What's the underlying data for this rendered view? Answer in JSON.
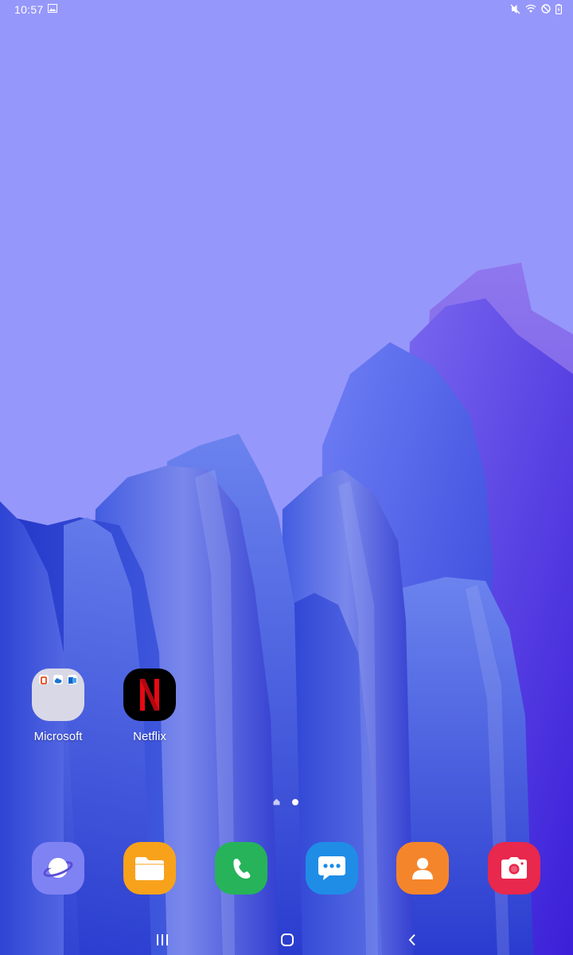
{
  "status_bar": {
    "time": "10:57",
    "icons": [
      "gallery-icon",
      "mute-icon",
      "wifi-icon",
      "do-not-disturb-icon",
      "battery-icon"
    ]
  },
  "home": {
    "apps": [
      {
        "label": "Microsoft",
        "icon": "folder-icon"
      },
      {
        "label": "Netflix",
        "icon": "netflix-icon",
        "glyph": "N"
      }
    ],
    "page_count": 2,
    "current_page": 2
  },
  "dock": [
    {
      "name": "internet",
      "icon": "planet-icon",
      "color": "#7f82f2"
    },
    {
      "name": "my-files",
      "icon": "folder-icon",
      "color": "#f8a21c"
    },
    {
      "name": "phone",
      "icon": "phone-icon",
      "color": "#26b35a"
    },
    {
      "name": "messages",
      "icon": "chat-bubble-icon",
      "color": "#1f8de6"
    },
    {
      "name": "contacts",
      "icon": "person-icon",
      "color": "#f5852b"
    },
    {
      "name": "camera",
      "icon": "camera-icon",
      "color": "#e8284c"
    }
  ],
  "nav_bar": {
    "buttons": [
      "recents-icon",
      "home-icon",
      "back-icon"
    ]
  },
  "colors": {
    "sky": "#9697fa",
    "netflix_red": "#e50914"
  }
}
